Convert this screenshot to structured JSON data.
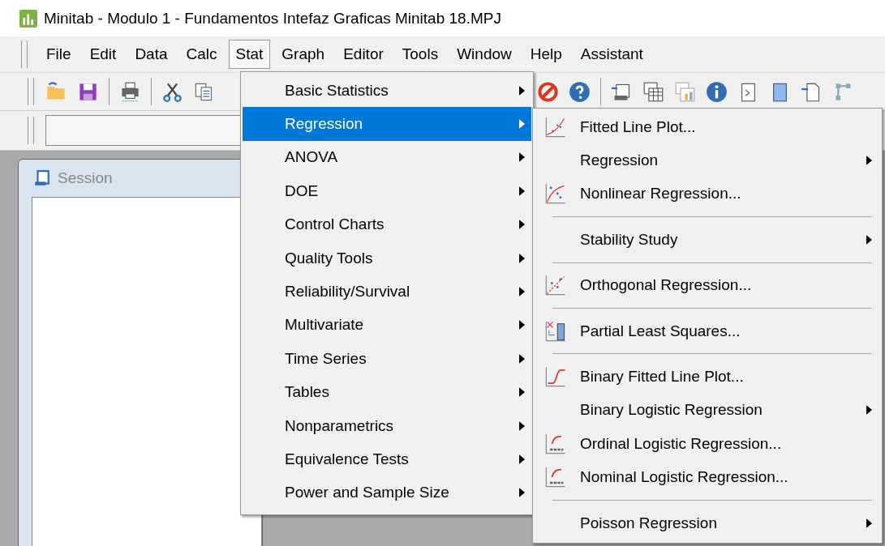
{
  "window": {
    "title": "Minitab - Modulo 1 - Fundamentos Intefaz Graficas Minitab 18.MPJ"
  },
  "menubar": [
    {
      "label": "File",
      "selected": false
    },
    {
      "label": "Edit",
      "selected": false
    },
    {
      "label": "Data",
      "selected": false
    },
    {
      "label": "Calc",
      "selected": false
    },
    {
      "label": "Stat",
      "selected": true
    },
    {
      "label": "Graph",
      "selected": false
    },
    {
      "label": "Editor",
      "selected": false
    },
    {
      "label": "Tools",
      "selected": false
    },
    {
      "label": "Window",
      "selected": false
    },
    {
      "label": "Help",
      "selected": false
    },
    {
      "label": "Assistant",
      "selected": false
    }
  ],
  "session_window": {
    "title": "Session"
  },
  "stat_menu": [
    {
      "label": "Basic Statistics",
      "selected": false
    },
    {
      "label": "Regression",
      "selected": true
    },
    {
      "label": "ANOVA",
      "selected": false
    },
    {
      "label": "DOE",
      "selected": false
    },
    {
      "label": "Control Charts",
      "selected": false
    },
    {
      "label": "Quality Tools",
      "selected": false
    },
    {
      "label": "Reliability/Survival",
      "selected": false
    },
    {
      "label": "Multivariate",
      "selected": false
    },
    {
      "label": "Time Series",
      "selected": false
    },
    {
      "label": "Tables",
      "selected": false
    },
    {
      "label": "Nonparametrics",
      "selected": false
    },
    {
      "label": "Equivalence Tests",
      "selected": false
    },
    {
      "label": "Power and Sample Size",
      "selected": false
    }
  ],
  "regression_submenu": [
    {
      "kind": "command",
      "label": "Fitted Line Plot..."
    },
    {
      "kind": "submenu",
      "label": "Regression"
    },
    {
      "kind": "command",
      "label": "Nonlinear Regression..."
    },
    {
      "kind": "separator"
    },
    {
      "kind": "submenu",
      "label": "Stability Study"
    },
    {
      "kind": "separator"
    },
    {
      "kind": "command",
      "label": "Orthogonal Regression..."
    },
    {
      "kind": "separator"
    },
    {
      "kind": "command",
      "label": "Partial Least Squares..."
    },
    {
      "kind": "separator"
    },
    {
      "kind": "command",
      "label": "Binary Fitted Line Plot..."
    },
    {
      "kind": "submenu",
      "label": "Binary Logistic Regression"
    },
    {
      "kind": "command",
      "label": "Ordinal Logistic Regression..."
    },
    {
      "kind": "command",
      "label": "Nominal Logistic Regression..."
    },
    {
      "kind": "separator"
    },
    {
      "kind": "submenu",
      "label": "Poisson Regression"
    }
  ]
}
